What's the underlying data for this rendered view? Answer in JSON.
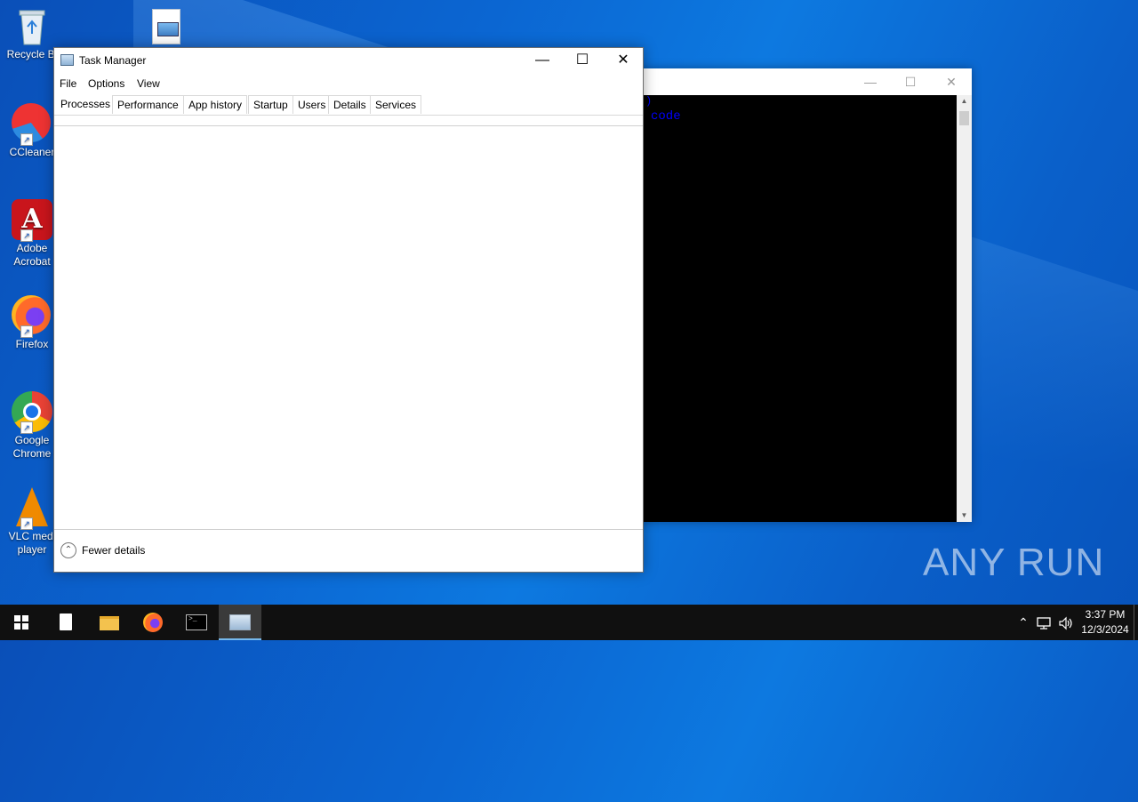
{
  "desktop": {
    "icons": [
      {
        "label": "Recycle Bi"
      },
      {
        "label": "CCleaner"
      },
      {
        "label": "Adobe Acrobat"
      },
      {
        "label": "Firefox"
      },
      {
        "label": "Google Chrome"
      },
      {
        "label": "VLC medi player"
      }
    ],
    "watermark": "ANY RUN"
  },
  "console": {
    "line1": ")",
    "line2": "code",
    "minimize_icon": "minimize-icon",
    "maximize_icon": "maximize-icon",
    "close_icon": "close-icon"
  },
  "task_manager": {
    "title": "Task Manager",
    "menu": [
      "File",
      "Options",
      "View"
    ],
    "tabs": [
      "Processes",
      "Performance",
      "App history",
      "Startup",
      "Users",
      "Details",
      "Services"
    ],
    "active_tab": "Processes",
    "footer_label": "Fewer details"
  },
  "taskbar": {
    "clock_time": "3:37 PM",
    "clock_date": "12/3/2024",
    "apps": [
      "start-icon",
      "file-icon",
      "file-explorer-icon",
      "firefox-icon",
      "cmd-icon",
      "task-manager-icon"
    ],
    "active_app": "task-manager-icon"
  }
}
